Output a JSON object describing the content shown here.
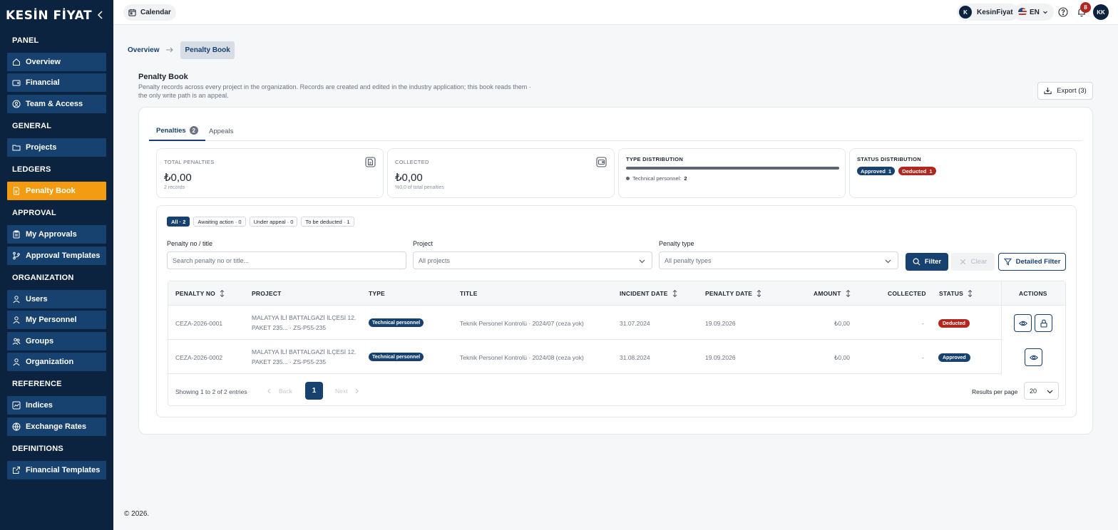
{
  "brand": {
    "name": "KESİN FİYAT"
  },
  "sidebar": {
    "sections": [
      {
        "title": "PANEL",
        "items": [
          "Overview",
          "Financial",
          "Team & Access"
        ]
      },
      {
        "title": "GENERAL",
        "items": [
          "Projects"
        ]
      },
      {
        "title": "LEDGERS",
        "items": [
          "Penalty Book"
        ]
      },
      {
        "title": "APPROVAL",
        "items": [
          "My Approvals",
          "Approval Templates"
        ]
      },
      {
        "title": "ORGANIZATION",
        "items": [
          "Users",
          "My Personnel",
          "Groups",
          "Organization"
        ]
      },
      {
        "title": "REFERENCE",
        "items": [
          "Indices",
          "Exchange Rates"
        ]
      },
      {
        "title": "DEFINITIONS",
        "items": [
          "Financial Templates"
        ]
      }
    ],
    "active_item": "Penalty Book",
    "active_color": "#f39c12"
  },
  "topbar": {
    "calendar_label": "Calendar",
    "user_initial": "K",
    "user_name": "KesinFiyat",
    "language": "EN",
    "notification_count": "8",
    "profile_initials": "KK"
  },
  "breadcrumb": {
    "items": [
      "Overview",
      "Penalty Book"
    ]
  },
  "page": {
    "title": "Penalty Book",
    "description": "Penalty records across every project in the organization. Records are created and edited in the industry application; this book reads them · the only write path is an appeal.",
    "export_label": "Export (3)"
  },
  "tabs": [
    {
      "label": "Penalties",
      "count": "2",
      "active": true
    },
    {
      "label": "Appeals",
      "active": false
    }
  ],
  "stats": {
    "total": {
      "label": "TOTAL PENALTIES",
      "value": "₺0,00",
      "sub": "2 records"
    },
    "collected": {
      "label": "COLLECTED",
      "value": "₺0,00",
      "sub": "%0,0 of total penalties"
    },
    "type_distribution": {
      "label": "TYPE DISTRIBUTION",
      "legend_name": "Technical personnel:",
      "legend_value": "2"
    },
    "status_distribution": {
      "label": "STATUS DISTRIBUTION",
      "approved_label": "Approved",
      "approved_count": "1",
      "deducted_label": "Deducted",
      "deducted_count": "1"
    }
  },
  "quick_filters": [
    "All · 2",
    "Awaiting action · 0",
    "Under appeal · 0",
    "To be deducted · 1"
  ],
  "filters": {
    "search_label": "Penalty no / title",
    "search_placeholder": "Search penalty no or title...",
    "project_label": "Project",
    "project_value": "All projects",
    "type_label": "Penalty type",
    "type_value": "All penalty types",
    "filter_btn": "Filter",
    "clear_btn": "Clear",
    "detailed_btn": "Detailed Filter"
  },
  "table": {
    "columns": [
      "PENALTY NO",
      "PROJECT",
      "TYPE",
      "TITLE",
      "INCIDENT DATE",
      "PENALTY DATE",
      "AMOUNT",
      "COLLECTED",
      "STATUS",
      "ACTIONS"
    ],
    "rows": [
      {
        "no": "CEZA-2026-0001",
        "project_line1": "MALATYA İLİ BATTALGAZİ İLÇESİ 12.",
        "project_line2": "PAKET 235... · ZS-P55-235",
        "type": "Technical personnel",
        "title": "Teknik Personel Kontrolü · 2024/07 (ceza yok)",
        "incident_date": "31.07.2024",
        "penalty_date": "19.09.2026",
        "amount": "₺0,00",
        "collected": "-",
        "status": "Deducted",
        "status_color": "#b3261e"
      },
      {
        "no": "CEZA-2026-0002",
        "project_line1": "MALATYA İLİ BATTALGAZİ İLÇESİ 12.",
        "project_line2": "PAKET 235... · ZS-P55-235",
        "type": "Technical personnel",
        "title": "Teknik Personel Kontrolü · 2024/08 (ceza yok)",
        "incident_date": "31.08.2024",
        "penalty_date": "19.09.2026",
        "amount": "₺0,00",
        "collected": "-",
        "status": "Approved",
        "status_color": "#17416f"
      }
    ]
  },
  "pagination": {
    "showing": "Showing 1 to 2 of 2 entries",
    "back": "Back",
    "next": "Next",
    "current": "1",
    "rpp_label": "Results per page",
    "rpp_value": "20"
  },
  "footer": {
    "text": "© 2026."
  }
}
